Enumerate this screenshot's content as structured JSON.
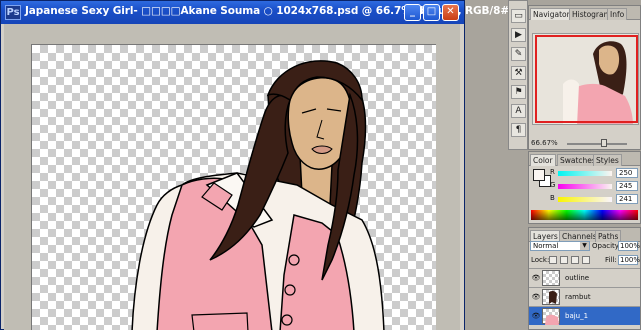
{
  "document": {
    "title": "Japanese Sexy Girl- □□□□Akane Souma ○ 1024x768.psd @ 66.7% (baju_1, RGB/8#)",
    "app_icon": "Ps"
  },
  "window_controls": {
    "minimize": "_",
    "maximize": "□",
    "close": "✕"
  },
  "tools": [
    "▭",
    "▶",
    "✎",
    "⚒",
    "⚑",
    "A",
    "¶",
    "✁"
  ],
  "navigator": {
    "tabs": [
      "Navigator",
      "Histogram",
      "Info"
    ],
    "active_tab": "Navigator",
    "zoom": "66.67%"
  },
  "color_panel": {
    "tabs": [
      "Color",
      "Swatches",
      "Styles"
    ],
    "active_tab": "Color",
    "channels": [
      {
        "label": "R",
        "value": "250"
      },
      {
        "label": "G",
        "value": "245"
      },
      {
        "label": "B",
        "value": "241"
      }
    ],
    "foreground": "#faf5f1"
  },
  "layers_panel": {
    "tabs": [
      "Layers",
      "Channels",
      "Paths"
    ],
    "active_tab": "Layers",
    "blend_mode": "Normal",
    "opacity_label": "Opacity:",
    "opacity_value": "100%",
    "lock_label": "Lock:",
    "fill_label": "Fill:",
    "fill_value": "100%",
    "layers": [
      {
        "name": "outline",
        "visible": true,
        "selected": false
      },
      {
        "name": "rambut",
        "visible": true,
        "selected": false
      },
      {
        "name": "baju_1",
        "visible": true,
        "selected": true
      }
    ]
  },
  "colors": {
    "hair": "#3a1f16",
    "skin": "#dcb58a",
    "vest": "#f3a5b0",
    "shirt": "#f7f1ea",
    "titlebar": "#1a4fc8"
  }
}
